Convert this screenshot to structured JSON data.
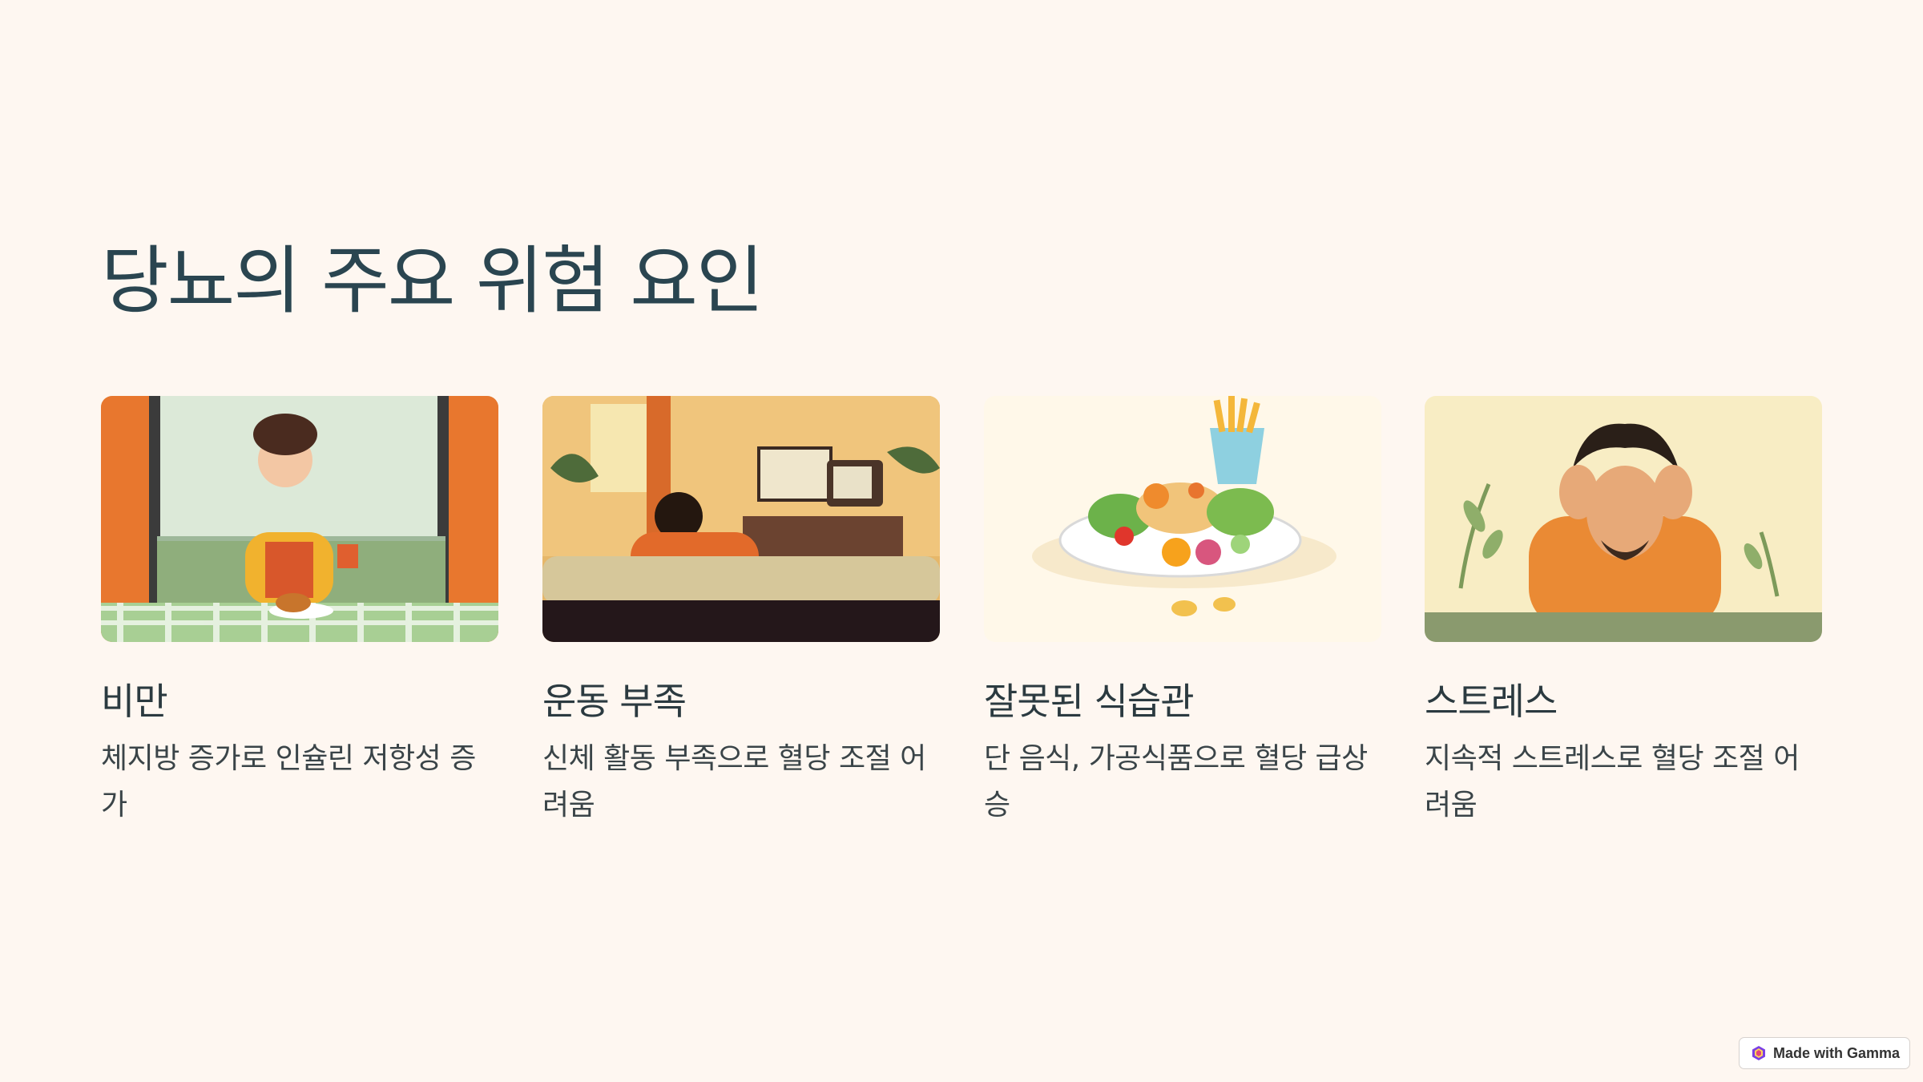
{
  "slide": {
    "title": "당뇨의 주요 위험 요인"
  },
  "cards": [
    {
      "title": "비만",
      "description": "체지방 증가로 인슐린 저항성 증가",
      "image_subject": "woman eating burger and fries at a table"
    },
    {
      "title": "운동 부족",
      "description": "신체 활동 부족으로 혈당 조절 어려움",
      "image_subject": "person on a sofa watching television"
    },
    {
      "title": "잘못된 식습관",
      "description": "단 음식, 가공식품으로 혈당 급상승",
      "image_subject": "plate of fried food, salad and fruit with fries cup"
    },
    {
      "title": "스트레스",
      "description": "지속적 스트레스로 혈당 조절 어려움",
      "image_subject": "stressed man holding his head"
    }
  ],
  "badge": {
    "label": "Made with Gamma",
    "icon": "gamma-logo-icon"
  },
  "colors": {
    "background": "#fef7f1",
    "title": "#2a4550",
    "text": "#3a4448",
    "accent_orange": "#e8772e"
  }
}
